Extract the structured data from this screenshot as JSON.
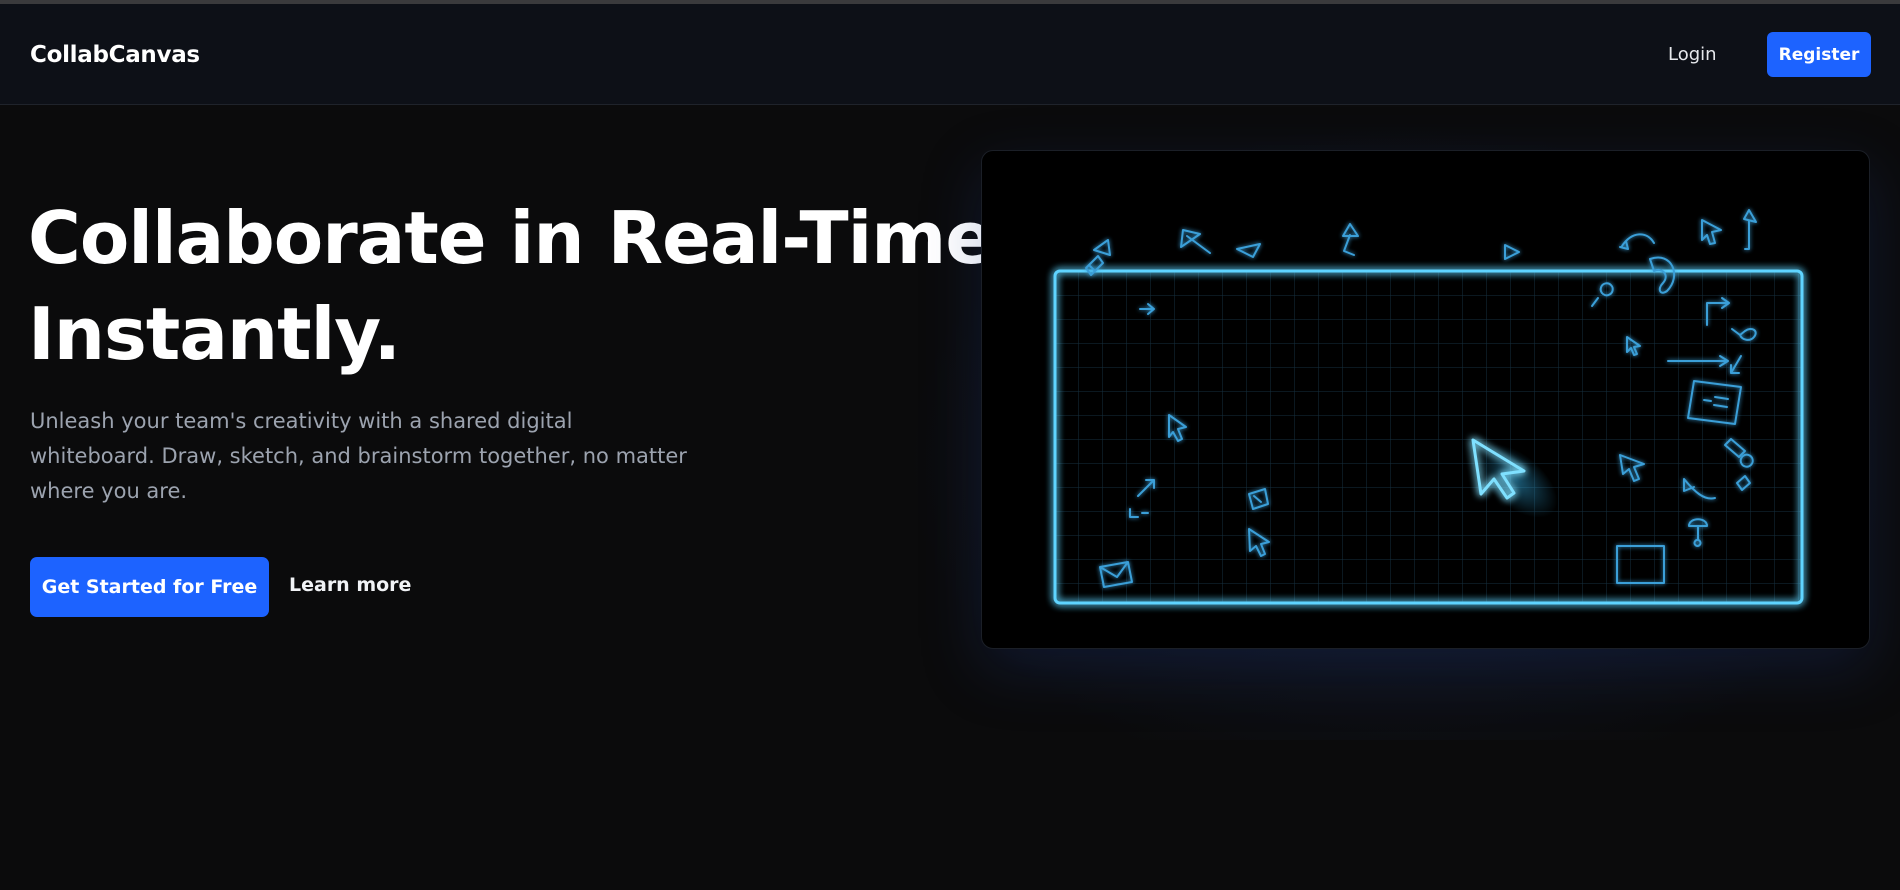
{
  "nav": {
    "brand": "CollabCanvas",
    "login_label": "Login",
    "register_label": "Register"
  },
  "hero": {
    "title_line1": "Collaborate in Real-Time,",
    "title_line2": "Instantly.",
    "subtitle": "Unleash your team's creativity with a shared digital whiteboard. Draw, sketch, and brainstorm together, no matter where you are.",
    "cta_label": "Get Started for Free",
    "learn_more_label": "Learn more"
  },
  "colors": {
    "accent": "#1d63ff",
    "neon": "#38bdf8",
    "background": "#0b0b0c",
    "navbar": "#0d1017"
  }
}
